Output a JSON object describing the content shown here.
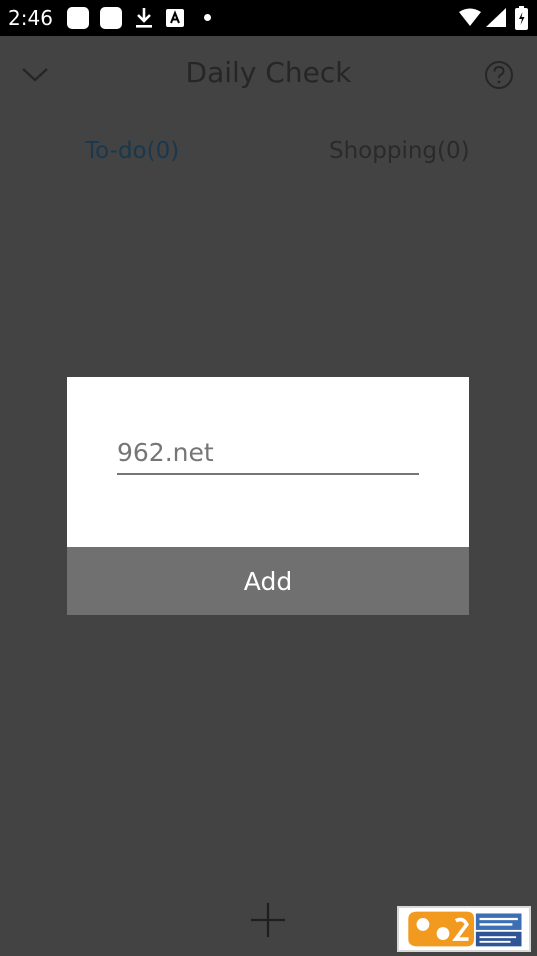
{
  "status_bar": {
    "time": "2:46",
    "icons": [
      "notification-icon",
      "notification-icon",
      "download-icon",
      "a-icon",
      "dot-icon",
      "wifi-icon",
      "signal-icon",
      "battery-icon"
    ]
  },
  "app_bar": {
    "title": "Daily Check",
    "icons": [
      "chevron-down-icon",
      "help-icon"
    ]
  },
  "tabs": [
    {
      "label": "To-do(0)",
      "active": true
    },
    {
      "label": "Shopping(0)",
      "active": false
    }
  ],
  "dialog": {
    "input_placeholder": "962.net",
    "add_label": "Add"
  },
  "fab": {
    "icon": "plus-icon"
  },
  "watermark": {
    "icon": "962-net-logo"
  },
  "colors": {
    "background": "#434343",
    "status_bar": "#000000",
    "active_tab": "#19384e",
    "inactive_tab": "#2a2a2a",
    "dialog_bg": "#ffffff",
    "add_button": "#707070"
  }
}
